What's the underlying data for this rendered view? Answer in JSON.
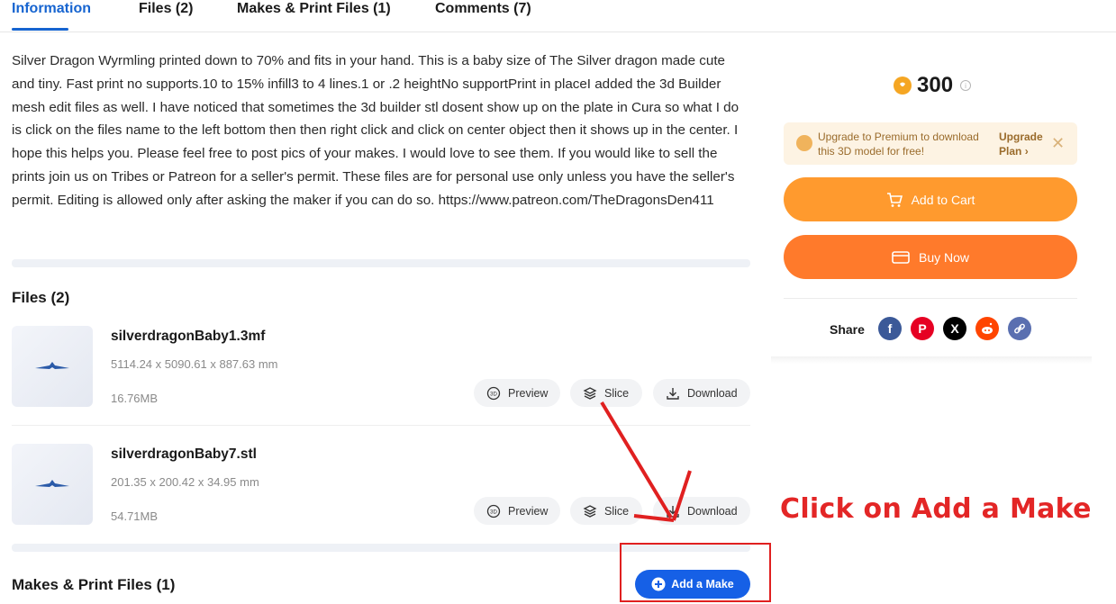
{
  "tabs": [
    {
      "label": "Information",
      "active": true
    },
    {
      "label": "Files (2)"
    },
    {
      "label": "Makes & Print Files (1)"
    },
    {
      "label": "Comments (7)"
    }
  ],
  "description": "Silver Dragon Wyrmling printed down to 70% and fits in your hand. This is a baby size of The Silver dragon made cute and tiny. Fast print no supports.10 to 15% infill3 to 4 lines.1 or .2 heightNo supportPrint in placeI added the 3d Builder mesh edit files as well. I have noticed that sometimes the 3d builder stl dosent show up on the plate in Cura so what I do is click on the files name to the left bottom then then right click and click on center object then it shows up in the center. I hope this helps you. Please feel free to post pics of your makes. I would love to see them. If you would like to sell the prints join us on Tribes or Patreon for a seller's permit. These files are for personal use only unless you have the seller's permit. Editing is allowed only after asking the maker if you can do so. https://www.patreon.com/TheDragonsDen411",
  "files_section": {
    "title": "Files (2)",
    "files": [
      {
        "name": "silverdragonBaby1.3mf",
        "dims": "5114.24 x 5090.61 x 887.63 mm",
        "size": "16.76MB"
      },
      {
        "name": "silverdragonBaby7.stl",
        "dims": "201.35 x 200.42 x 34.95 mm",
        "size": "54.71MB"
      }
    ],
    "actions": {
      "preview": "Preview",
      "slice": "Slice",
      "download": "Download"
    }
  },
  "makes_section": {
    "title": "Makes & Print Files (1)",
    "add_make": "Add a Make"
  },
  "sidebar": {
    "price": "300",
    "upgrade_text": "Upgrade to Premium to download this 3D model for free!",
    "upgrade_link_line1": "Upgrade",
    "upgrade_link_line2": "Plan",
    "add_to_cart": "Add to Cart",
    "buy_now": "Buy Now",
    "share_label": "Share",
    "share_icons": [
      "facebook-icon",
      "pinterest-icon",
      "x-icon",
      "reddit-icon",
      "link-icon"
    ]
  },
  "annotation": {
    "text": "Click on Add a Make",
    "color": "#e32626"
  },
  "colors": {
    "accent": "#1664d0",
    "cart": "#ff9a2e",
    "buy": "#ff7a2b",
    "add_make": "#1660e6"
  }
}
